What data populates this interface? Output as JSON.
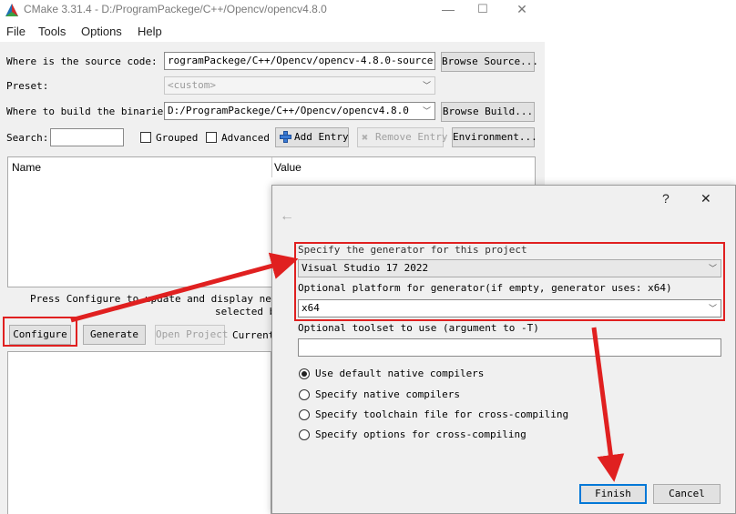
{
  "window": {
    "title": "CMake 3.31.4 - D:/ProgramPackege/C++/Opencv/opencv4.8.0"
  },
  "menu": [
    "File",
    "Tools",
    "Options",
    "Help"
  ],
  "source": {
    "label": "Where is the source code:",
    "value": "rogramPackege/C++/Opencv/opencv-4.8.0-source-code",
    "button": "Browse Source..."
  },
  "preset": {
    "label": "Preset:",
    "value": "<custom>"
  },
  "build": {
    "label": "Where to build the binaries:",
    "value": "D:/ProgramPackege/C++/Opencv/opencv4.8.0",
    "button": "Browse Build..."
  },
  "search": {
    "label": "Search:",
    "value": ""
  },
  "options": {
    "grouped": "Grouped",
    "advanced": "Advanced",
    "add_entry": "Add Entry",
    "remove_entry": "Remove Entry",
    "environment": "Environment..."
  },
  "table": {
    "col_name": "Name",
    "col_value": "Value"
  },
  "status": {
    "line1": "Press Configure to update and display new va",
    "line2": "selected bu"
  },
  "actions": {
    "configure": "Configure",
    "generate": "Generate",
    "open_project": "Open Project",
    "current": "Current"
  },
  "dialog": {
    "help": "?",
    "close": "✕",
    "back": "←",
    "generator_label": "Specify the generator for this project",
    "generator_value": "Visual Studio 17 2022",
    "platform_label": "Optional platform for generator(if empty, generator uses: x64)",
    "platform_value": "x64",
    "toolset_label": "Optional toolset to use (argument to -T)",
    "toolset_value": "",
    "radios": [
      {
        "label": "Use default native compilers",
        "checked": true
      },
      {
        "label": "Specify native compilers",
        "checked": false
      },
      {
        "label": "Specify toolchain file for cross-compiling",
        "checked": false
      },
      {
        "label": "Specify options for cross-compiling",
        "checked": false
      }
    ],
    "finish": "Finish",
    "cancel": "Cancel"
  },
  "colors": {
    "annotation_red": "#e02020",
    "accent_blue": "#0078d7"
  }
}
